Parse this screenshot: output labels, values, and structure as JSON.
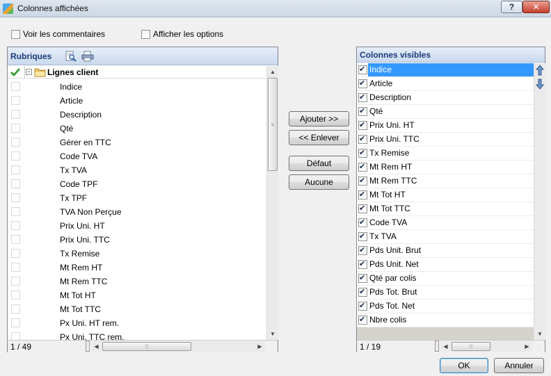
{
  "window": {
    "title": "Colonnes affichées",
    "help_label": "?",
    "close_label": "✕"
  },
  "options": {
    "show_comments": {
      "label": "Voir les commentaires",
      "checked": false
    },
    "show_options": {
      "label": "Afficher les options",
      "checked": false
    }
  },
  "left_panel": {
    "header": "Rubriques",
    "group": "Lignes client",
    "items": [
      "Indice",
      "Article",
      "Description",
      "Qté",
      "Gérer en TTC",
      "Code TVA",
      "Tx TVA",
      "Code TPF",
      "Tx TPF",
      "TVA Non Perçue",
      "Prix Uni. HT",
      "Prix Uni. TTC",
      "Tx Remise",
      "Mt Rem HT",
      "Mt Rem TTC",
      "Mt Tot HT",
      "Mt Tot TTC",
      "Px Uni. HT rem.",
      "Px Uni. TTC rem."
    ],
    "status": "1 / 49"
  },
  "actions": {
    "add": "Ajouter >>",
    "remove": "<< Enlever",
    "default": "Défaut",
    "none": "Aucune"
  },
  "right_panel": {
    "header": "Colonnes visibles",
    "items": [
      "Indice",
      "Article",
      "Description",
      "Qté",
      "Prix Uni. HT",
      "Prix Uni. TTC",
      "Tx Remise",
      "Mt Rem HT",
      "Mt Rem TTC",
      "Mt Tot HT",
      "Mt Tot TTC",
      "Code TVA",
      "Tx TVA",
      "Pds Unit. Brut",
      "Pds Unit. Net",
      "Qté par colis",
      "Pds Tot. Brut",
      "Pds Tot. Net",
      "Nbre colis"
    ],
    "selected_index": 0,
    "status": "1 / 19"
  },
  "footer": {
    "ok": "OK",
    "cancel": "Annuler"
  },
  "icons": {
    "title": "app-icon",
    "check_all": "checkmark-icon",
    "folder": "folder-icon",
    "search": "search-document-icon",
    "print": "print-icon"
  },
  "colors": {
    "selection": "#3399ff",
    "header_text": "#1b3c79",
    "check_green": "#2a9a2a"
  }
}
